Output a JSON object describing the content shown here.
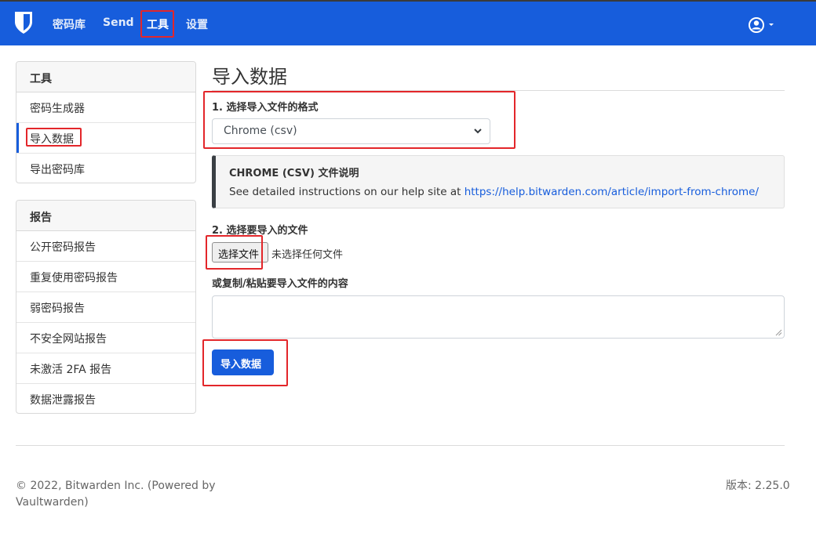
{
  "navbar": {
    "items": [
      {
        "label": "密码库"
      },
      {
        "label": "Send"
      },
      {
        "label": "工具"
      },
      {
        "label": "设置"
      }
    ],
    "brand_color": "#175ddc"
  },
  "sidebar": {
    "tools": {
      "header": "工具",
      "items": [
        {
          "label": "密码生成器"
        },
        {
          "label": "导入数据"
        },
        {
          "label": "导出密码库"
        }
      ]
    },
    "reports": {
      "header": "报告",
      "items": [
        {
          "label": "公开密码报告"
        },
        {
          "label": "重复使用密码报告"
        },
        {
          "label": "弱密码报告"
        },
        {
          "label": "不安全网站报告"
        },
        {
          "label": "未激活 2FA 报告"
        },
        {
          "label": "数据泄露报告"
        }
      ]
    }
  },
  "main": {
    "title": "导入数据",
    "format_label": "1. 选择导入文件的格式",
    "format_value": "Chrome (csv)",
    "callout": {
      "title": "CHROME (CSV) 文件说明",
      "text": "See detailed instructions on our help site at ",
      "link": "https://help.bitwarden.com/article/import-from-chrome/"
    },
    "file_label": "2. 选择要导入的文件",
    "file_button": "选择文件",
    "file_status": "未选择任何文件",
    "paste_label": "或复制/粘贴要导入文件的内容",
    "submit_button": "导入数据"
  },
  "footer": {
    "copyright": "© 2022, Bitwarden Inc. (Powered by Vaultwarden)",
    "version": "版本: 2.25.0"
  },
  "colors": {
    "accent": "#175ddc",
    "highlight_box": "#e3262a"
  }
}
